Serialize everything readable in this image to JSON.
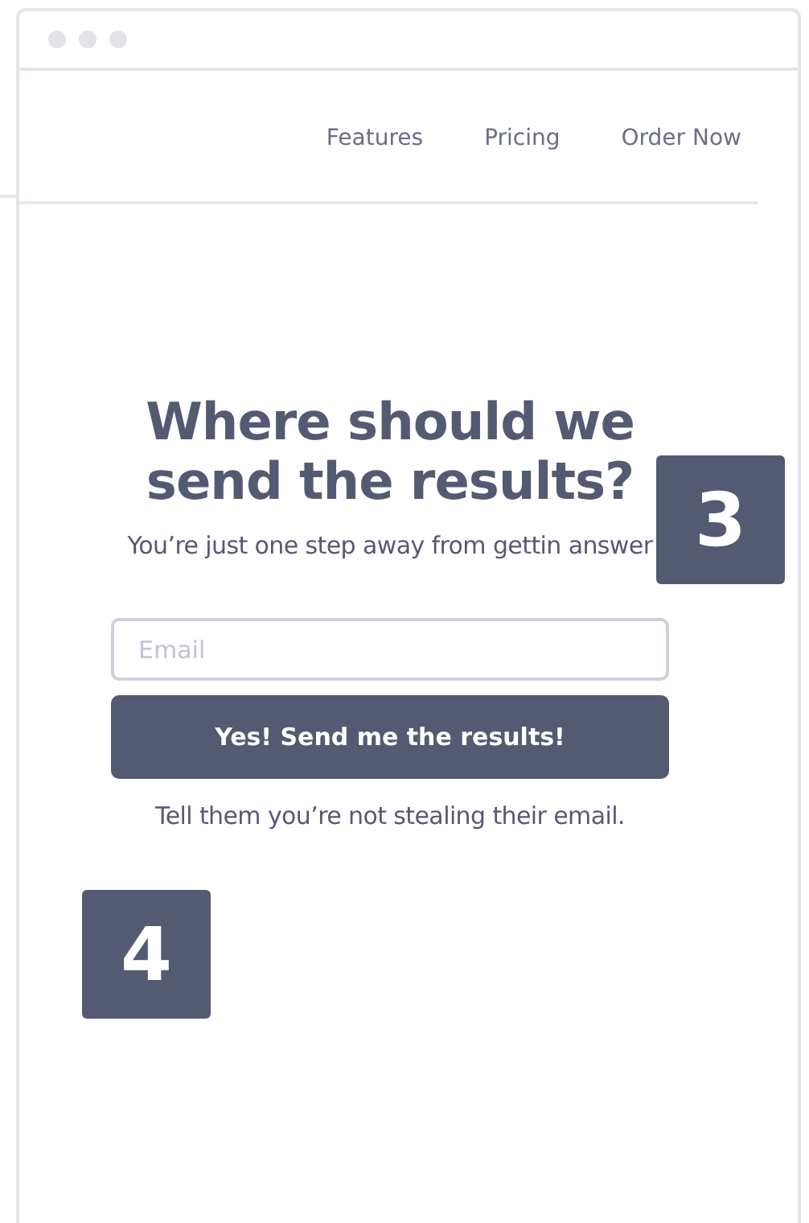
{
  "nav": [
    {
      "label": "Features"
    },
    {
      "label": "Pricing"
    },
    {
      "label": "Order Now"
    }
  ],
  "heading": "Where should we send the results?",
  "subtitle": "You’re just one step away from gettin answer",
  "email_field": {
    "placeholder": "Email"
  },
  "submit_button": "Yes! Send me the results!",
  "note": "Tell them you’re not stealing their email.",
  "step_badges": [
    "3",
    "4"
  ]
}
